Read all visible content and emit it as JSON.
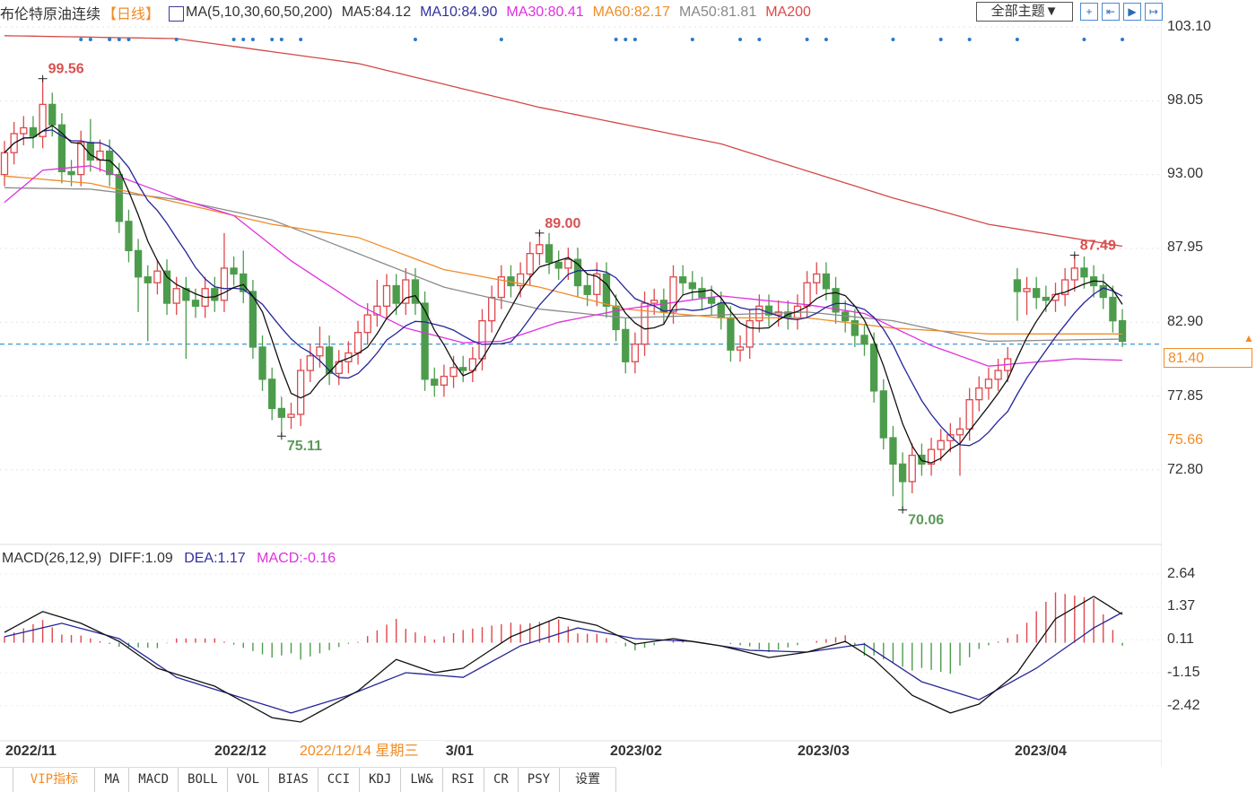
{
  "header": {
    "title": "布伦特原油连续",
    "period": "【日线】",
    "ma_params": "MA(5,10,30,60,50,200)",
    "ma5": "MA5:84.12",
    "ma10": "MA10:84.90",
    "ma30": "MA30:80.41",
    "ma60": "MA60:82.17",
    "ma50": "MA50:81.81",
    "ma200": "MA200",
    "theme_button": "全部主题▼",
    "tools": [
      "+",
      "⇤",
      "▶",
      "↦"
    ]
  },
  "colors": {
    "up": "#e0474c",
    "down": "#4c9c4c",
    "ma5": "#111111",
    "ma10": "#25259a",
    "ma30": "#e030e0",
    "ma60": "#f08c28",
    "ma50": "#8a8a8a",
    "ma200": "#d24a46",
    "diff": "#111111",
    "dea": "#25259a",
    "accent": "#f08c28",
    "dash": "#2a8ad0"
  },
  "price_axis": [
    "103.10",
    "98.05",
    "93.00",
    "87.95",
    "82.90",
    "77.85",
    "72.80"
  ],
  "current_price": "81.40",
  "marked_price": "75.66",
  "annotations": {
    "high1": "99.56",
    "low1": "75.11",
    "high2": "89.00",
    "high3": "87.49",
    "low2": "70.06"
  },
  "macd_header": {
    "params": "MACD(26,12,9)",
    "diff": "DIFF:1.09",
    "dea": "DEA:1.17",
    "macd": "MACD:-0.16"
  },
  "macd_axis": [
    "2.64",
    "1.37",
    "0.11",
    "-1.15",
    "-2.42"
  ],
  "dates": [
    "2022/11",
    "2022/12",
    "2023/01",
    "2023/02",
    "2023/03",
    "2023/04"
  ],
  "tooltip_date": "2022/12/14 星期三",
  "tabs": [
    "VIP指标",
    "MA",
    "MACD",
    "BOLL",
    "VOL",
    "BIAS",
    "CCI",
    "KDJ",
    "LW&",
    "RSI",
    "CR",
    "PSY",
    "设置"
  ],
  "chart_data": {
    "type": "candlestick",
    "ylim": [
      68.5,
      104
    ],
    "open": [
      93.0,
      94.5,
      95.8,
      96.2,
      95.6,
      97.8,
      96.4,
      93.2,
      93.0,
      95.2,
      94.0,
      94.6,
      93.0,
      89.8,
      87.8,
      86.0,
      85.6,
      86.4,
      84.2,
      85.2,
      84.4,
      84.0,
      85.2,
      84.4,
      86.6,
      86.2,
      85.0,
      81.2,
      79.0,
      77.0,
      76.4,
      76.6,
      79.6,
      80.6,
      81.2,
      79.4,
      80.2,
      80.8,
      82.2,
      83.4,
      84.0,
      85.4,
      84.2,
      85.8,
      84.2,
      79.0,
      78.6,
      79.2,
      79.8,
      79.6,
      80.4,
      83.0,
      84.6,
      86.0,
      85.4,
      86.2,
      87.6,
      88.2,
      87.0,
      86.6,
      87.2,
      85.4,
      84.8,
      86.2,
      84.0,
      82.4,
      80.2,
      81.4,
      84.2,
      84.4,
      83.6,
      86.0,
      85.6,
      85.2,
      84.6,
      84.2,
      83.2,
      81.0,
      81.2,
      83.0,
      84.0,
      83.4,
      83.6,
      83.2,
      84.0,
      85.6,
      86.2,
      85.2,
      83.6,
      83.0,
      82.0,
      81.4,
      78.2,
      75.0,
      73.2,
      72.0,
      73.8,
      73.2,
      74.2,
      74.8,
      75.2,
      75.6,
      77.6,
      78.4,
      79.0,
      79.6,
      85.8,
      85.0,
      85.2,
      84.6,
      84.4,
      84.8,
      85.8,
      86.6,
      86.0,
      85.4,
      84.6,
      83.0
    ],
    "close": [
      94.5,
      95.8,
      96.2,
      95.6,
      97.8,
      96.4,
      93.2,
      93.0,
      95.2,
      94.0,
      94.6,
      93.0,
      89.8,
      87.8,
      86.0,
      85.6,
      86.4,
      84.2,
      85.2,
      84.4,
      84.0,
      85.2,
      84.4,
      86.6,
      86.2,
      85.0,
      81.2,
      79.0,
      77.0,
      76.4,
      76.6,
      79.6,
      80.6,
      81.2,
      79.4,
      80.2,
      80.8,
      82.2,
      83.4,
      84.0,
      85.4,
      84.2,
      85.8,
      84.2,
      79.0,
      78.6,
      79.2,
      79.8,
      79.6,
      80.4,
      83.0,
      84.6,
      86.0,
      85.4,
      86.2,
      87.6,
      88.2,
      87.0,
      86.6,
      87.2,
      85.4,
      84.8,
      86.2,
      84.0,
      82.4,
      80.2,
      81.4,
      84.2,
      84.4,
      83.6,
      86.0,
      85.6,
      85.2,
      84.6,
      84.2,
      83.2,
      81.0,
      81.2,
      83.0,
      84.0,
      83.4,
      83.6,
      83.2,
      84.0,
      85.6,
      86.2,
      85.2,
      83.6,
      83.0,
      82.0,
      81.4,
      78.2,
      75.0,
      73.2,
      72.0,
      73.8,
      73.2,
      74.2,
      74.8,
      75.2,
      75.6,
      77.6,
      78.4,
      79.0,
      79.6,
      80.4,
      85.0,
      85.2,
      84.6,
      84.4,
      84.8,
      85.8,
      86.6,
      86.0,
      85.4,
      84.6,
      83.0,
      81.6
    ],
    "high": [
      95.3,
      96.6,
      97.0,
      97.0,
      99.56,
      98.6,
      97.2,
      94.0,
      96.0,
      96.8,
      95.4,
      95.4,
      93.8,
      90.6,
      88.6,
      86.8,
      87.2,
      87.2,
      86.0,
      86.0,
      85.2,
      86.0,
      86.0,
      89.0,
      87.4,
      87.8,
      85.8,
      82.0,
      79.8,
      77.8,
      77.4,
      80.4,
      81.4,
      82.6,
      82.0,
      81.0,
      81.6,
      83.0,
      84.2,
      85.8,
      86.2,
      86.2,
      86.6,
      86.6,
      85.0,
      79.8,
      80.0,
      80.6,
      80.6,
      81.2,
      83.8,
      85.4,
      86.8,
      86.8,
      87.0,
      88.4,
      89.0,
      89.0,
      87.8,
      88.0,
      88.0,
      86.2,
      87.0,
      87.0,
      84.8,
      83.2,
      82.2,
      85.0,
      85.2,
      85.2,
      86.8,
      86.8,
      86.4,
      86.0,
      85.4,
      85.0,
      84.0,
      82.0,
      83.8,
      84.8,
      84.8,
      84.4,
      84.4,
      84.8,
      86.4,
      87.0,
      87.0,
      86.0,
      84.4,
      83.8,
      82.8,
      82.2,
      79.0,
      75.8,
      74.0,
      74.6,
      74.6,
      75.0,
      75.6,
      76.0,
      76.4,
      78.4,
      79.2,
      79.8,
      80.4,
      81.2,
      86.6,
      86.0,
      86.0,
      85.4,
      85.6,
      86.6,
      87.49,
      87.4,
      86.8,
      86.2,
      85.4,
      83.8
    ],
    "low": [
      92.2,
      93.7,
      95.0,
      94.8,
      94.8,
      95.6,
      92.4,
      92.2,
      92.2,
      93.2,
      93.2,
      92.2,
      89.0,
      87.0,
      83.6,
      81.6,
      84.8,
      83.4,
      83.4,
      80.4,
      83.2,
      83.2,
      83.6,
      83.6,
      85.4,
      84.2,
      80.4,
      78.2,
      76.2,
      75.11,
      75.6,
      75.8,
      78.8,
      79.8,
      78.6,
      78.6,
      79.4,
      80.0,
      81.4,
      82.6,
      83.2,
      83.4,
      83.4,
      83.4,
      78.2,
      77.8,
      77.8,
      78.4,
      78.8,
      78.8,
      79.6,
      82.2,
      83.8,
      84.6,
      84.6,
      85.4,
      86.8,
      86.2,
      85.8,
      85.8,
      84.6,
      84.0,
      84.0,
      83.2,
      81.6,
      79.4,
      79.4,
      80.6,
      83.4,
      82.8,
      82.8,
      84.8,
      84.4,
      83.8,
      83.4,
      82.4,
      80.2,
      80.2,
      80.4,
      82.2,
      82.6,
      82.6,
      82.4,
      82.4,
      83.2,
      84.8,
      84.4,
      82.8,
      82.2,
      81.2,
      80.6,
      77.4,
      74.2,
      71.0,
      70.06,
      71.2,
      72.4,
      72.4,
      73.4,
      74.0,
      72.4,
      74.8,
      76.8,
      77.6,
      78.2,
      78.8,
      83.0,
      83.4,
      83.8,
      83.6,
      83.6,
      84.0,
      85.0,
      85.2,
      84.6,
      83.8,
      82.2,
      81.2
    ],
    "ma30": [
      [
        0,
        91.1
      ],
      [
        4,
        93.3
      ],
      [
        9,
        93.6
      ],
      [
        18,
        91.4
      ],
      [
        24,
        90.2
      ],
      [
        30,
        87.1
      ],
      [
        37,
        84.1
      ],
      [
        42,
        82.5
      ],
      [
        48,
        81.5
      ],
      [
        52,
        81.6
      ],
      [
        58,
        82.9
      ],
      [
        65,
        83.8
      ],
      [
        75,
        84.7
      ],
      [
        84,
        84.1
      ],
      [
        90,
        83.5
      ],
      [
        97,
        81.3
      ],
      [
        103,
        79.9
      ],
      [
        112,
        80.4
      ],
      [
        117,
        80.3
      ]
    ],
    "ma60": [
      [
        0,
        92.9
      ],
      [
        9,
        92.4
      ],
      [
        18,
        91.1
      ],
      [
        28,
        89.6
      ],
      [
        37,
        88.7
      ],
      [
        46,
        86.5
      ],
      [
        56,
        85.3
      ],
      [
        65,
        83.8
      ],
      [
        75,
        83.2
      ],
      [
        84,
        83.2
      ],
      [
        93,
        82.5
      ],
      [
        103,
        82.1
      ],
      [
        117,
        82.1
      ]
    ],
    "ma50": [
      [
        0,
        92.1
      ],
      [
        9,
        92.0
      ],
      [
        18,
        91.3
      ],
      [
        28,
        89.9
      ],
      [
        37,
        87.6
      ],
      [
        46,
        85.3
      ],
      [
        56,
        83.8
      ],
      [
        65,
        83.2
      ],
      [
        75,
        83.4
      ],
      [
        84,
        83.6
      ],
      [
        93,
        83.0
      ],
      [
        103,
        81.6
      ],
      [
        117,
        81.75
      ]
    ],
    "ma200": [
      [
        0,
        102.5
      ],
      [
        18,
        102.3
      ],
      [
        37,
        100.6
      ],
      [
        56,
        97.6
      ],
      [
        75,
        95.1
      ],
      [
        93,
        91.4
      ],
      [
        103,
        89.6
      ],
      [
        117,
        88.1
      ]
    ],
    "macd_diff": [
      [
        0,
        0.4
      ],
      [
        4,
        1.2
      ],
      [
        8,
        0.75
      ],
      [
        12,
        0.05
      ],
      [
        16,
        -0.98
      ],
      [
        22,
        -1.67
      ],
      [
        28,
        -2.88
      ],
      [
        31,
        -3.05
      ],
      [
        37,
        -1.85
      ],
      [
        41,
        -0.64
      ],
      [
        45,
        -1.15
      ],
      [
        48,
        -0.98
      ],
      [
        53,
        0.23
      ],
      [
        58,
        0.98
      ],
      [
        62,
        0.67
      ],
      [
        66,
        -0.05
      ],
      [
        70,
        0.16
      ],
      [
        75,
        -0.12
      ],
      [
        80,
        -0.57
      ],
      [
        84,
        -0.36
      ],
      [
        88,
        0.05
      ],
      [
        91,
        -0.64
      ],
      [
        95,
        -2.02
      ],
      [
        99,
        -2.7
      ],
      [
        102,
        -2.36
      ],
      [
        106,
        -1.15
      ],
      [
        110,
        0.92
      ],
      [
        114,
        1.78
      ],
      [
        117,
        1.09
      ]
    ],
    "macd_dea": [
      [
        0,
        0.23
      ],
      [
        6,
        0.75
      ],
      [
        12,
        0.16
      ],
      [
        18,
        -1.33
      ],
      [
        24,
        -2.02
      ],
      [
        30,
        -2.7
      ],
      [
        36,
        -2.02
      ],
      [
        42,
        -1.15
      ],
      [
        48,
        -1.33
      ],
      [
        54,
        -0.12
      ],
      [
        60,
        0.57
      ],
      [
        66,
        0.16
      ],
      [
        72,
        0.05
      ],
      [
        78,
        -0.29
      ],
      [
        84,
        -0.36
      ],
      [
        90,
        -0.05
      ],
      [
        96,
        -1.5
      ],
      [
        102,
        -2.19
      ],
      [
        108,
        -0.98
      ],
      [
        114,
        0.57
      ],
      [
        117,
        1.17
      ]
    ],
    "macd_ylim": [
      -3.3,
      2.8
    ],
    "signal_markers": [
      8,
      9,
      11,
      12,
      13,
      18,
      24,
      25,
      26,
      28,
      29,
      31,
      43,
      52,
      64,
      65,
      66,
      72,
      77,
      79,
      84,
      86,
      93,
      98,
      101,
      106,
      113,
      117
    ]
  }
}
